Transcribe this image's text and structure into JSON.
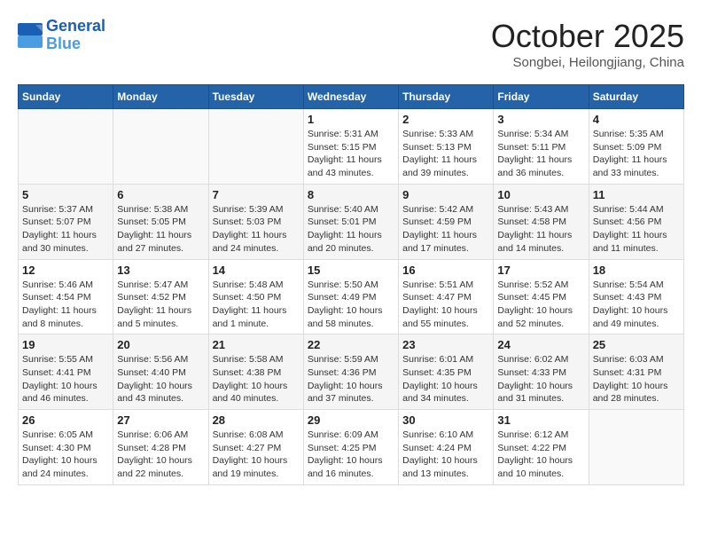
{
  "header": {
    "logo_line1": "General",
    "logo_line2": "Blue",
    "month": "October 2025",
    "location": "Songbei, Heilongjiang, China"
  },
  "weekdays": [
    "Sunday",
    "Monday",
    "Tuesday",
    "Wednesday",
    "Thursday",
    "Friday",
    "Saturday"
  ],
  "weeks": [
    [
      {
        "day": "",
        "info": ""
      },
      {
        "day": "",
        "info": ""
      },
      {
        "day": "",
        "info": ""
      },
      {
        "day": "1",
        "info": "Sunrise: 5:31 AM\nSunset: 5:15 PM\nDaylight: 11 hours\nand 43 minutes."
      },
      {
        "day": "2",
        "info": "Sunrise: 5:33 AM\nSunset: 5:13 PM\nDaylight: 11 hours\nand 39 minutes."
      },
      {
        "day": "3",
        "info": "Sunrise: 5:34 AM\nSunset: 5:11 PM\nDaylight: 11 hours\nand 36 minutes."
      },
      {
        "day": "4",
        "info": "Sunrise: 5:35 AM\nSunset: 5:09 PM\nDaylight: 11 hours\nand 33 minutes."
      }
    ],
    [
      {
        "day": "5",
        "info": "Sunrise: 5:37 AM\nSunset: 5:07 PM\nDaylight: 11 hours\nand 30 minutes."
      },
      {
        "day": "6",
        "info": "Sunrise: 5:38 AM\nSunset: 5:05 PM\nDaylight: 11 hours\nand 27 minutes."
      },
      {
        "day": "7",
        "info": "Sunrise: 5:39 AM\nSunset: 5:03 PM\nDaylight: 11 hours\nand 24 minutes."
      },
      {
        "day": "8",
        "info": "Sunrise: 5:40 AM\nSunset: 5:01 PM\nDaylight: 11 hours\nand 20 minutes."
      },
      {
        "day": "9",
        "info": "Sunrise: 5:42 AM\nSunset: 4:59 PM\nDaylight: 11 hours\nand 17 minutes."
      },
      {
        "day": "10",
        "info": "Sunrise: 5:43 AM\nSunset: 4:58 PM\nDaylight: 11 hours\nand 14 minutes."
      },
      {
        "day": "11",
        "info": "Sunrise: 5:44 AM\nSunset: 4:56 PM\nDaylight: 11 hours\nand 11 minutes."
      }
    ],
    [
      {
        "day": "12",
        "info": "Sunrise: 5:46 AM\nSunset: 4:54 PM\nDaylight: 11 hours\nand 8 minutes."
      },
      {
        "day": "13",
        "info": "Sunrise: 5:47 AM\nSunset: 4:52 PM\nDaylight: 11 hours\nand 5 minutes."
      },
      {
        "day": "14",
        "info": "Sunrise: 5:48 AM\nSunset: 4:50 PM\nDaylight: 11 hours\nand 1 minute."
      },
      {
        "day": "15",
        "info": "Sunrise: 5:50 AM\nSunset: 4:49 PM\nDaylight: 10 hours\nand 58 minutes."
      },
      {
        "day": "16",
        "info": "Sunrise: 5:51 AM\nSunset: 4:47 PM\nDaylight: 10 hours\nand 55 minutes."
      },
      {
        "day": "17",
        "info": "Sunrise: 5:52 AM\nSunset: 4:45 PM\nDaylight: 10 hours\nand 52 minutes."
      },
      {
        "day": "18",
        "info": "Sunrise: 5:54 AM\nSunset: 4:43 PM\nDaylight: 10 hours\nand 49 minutes."
      }
    ],
    [
      {
        "day": "19",
        "info": "Sunrise: 5:55 AM\nSunset: 4:41 PM\nDaylight: 10 hours\nand 46 minutes."
      },
      {
        "day": "20",
        "info": "Sunrise: 5:56 AM\nSunset: 4:40 PM\nDaylight: 10 hours\nand 43 minutes."
      },
      {
        "day": "21",
        "info": "Sunrise: 5:58 AM\nSunset: 4:38 PM\nDaylight: 10 hours\nand 40 minutes."
      },
      {
        "day": "22",
        "info": "Sunrise: 5:59 AM\nSunset: 4:36 PM\nDaylight: 10 hours\nand 37 minutes."
      },
      {
        "day": "23",
        "info": "Sunrise: 6:01 AM\nSunset: 4:35 PM\nDaylight: 10 hours\nand 34 minutes."
      },
      {
        "day": "24",
        "info": "Sunrise: 6:02 AM\nSunset: 4:33 PM\nDaylight: 10 hours\nand 31 minutes."
      },
      {
        "day": "25",
        "info": "Sunrise: 6:03 AM\nSunset: 4:31 PM\nDaylight: 10 hours\nand 28 minutes."
      }
    ],
    [
      {
        "day": "26",
        "info": "Sunrise: 6:05 AM\nSunset: 4:30 PM\nDaylight: 10 hours\nand 24 minutes."
      },
      {
        "day": "27",
        "info": "Sunrise: 6:06 AM\nSunset: 4:28 PM\nDaylight: 10 hours\nand 22 minutes."
      },
      {
        "day": "28",
        "info": "Sunrise: 6:08 AM\nSunset: 4:27 PM\nDaylight: 10 hours\nand 19 minutes."
      },
      {
        "day": "29",
        "info": "Sunrise: 6:09 AM\nSunset: 4:25 PM\nDaylight: 10 hours\nand 16 minutes."
      },
      {
        "day": "30",
        "info": "Sunrise: 6:10 AM\nSunset: 4:24 PM\nDaylight: 10 hours\nand 13 minutes."
      },
      {
        "day": "31",
        "info": "Sunrise: 6:12 AM\nSunset: 4:22 PM\nDaylight: 10 hours\nand 10 minutes."
      },
      {
        "day": "",
        "info": ""
      }
    ]
  ]
}
